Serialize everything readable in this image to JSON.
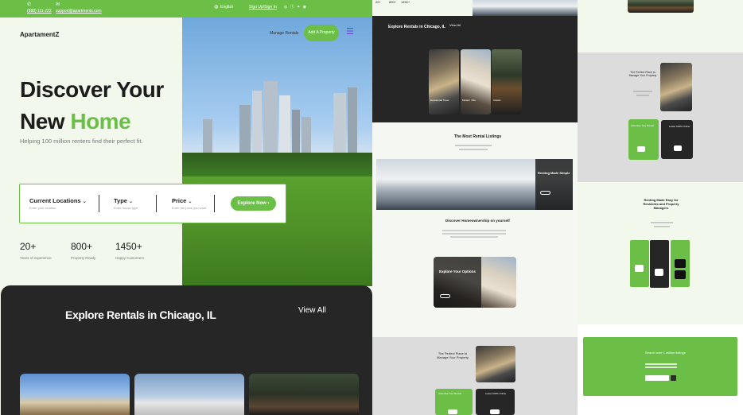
{
  "topbar": {
    "phone": "(888) 111-222",
    "email": "support@apartments.com",
    "language": "English",
    "signin": "Sign Up/Sign In"
  },
  "nav": {
    "logo": "ApartamentZ",
    "manage_rentals": "Manage Rentals",
    "add_property": "Add A Property"
  },
  "hero": {
    "title_line1": "Discover Your",
    "title_line2_a": "New ",
    "title_line2_b": "Home",
    "subtitle": "Helping 100 million renters find their perfect fit."
  },
  "search": {
    "location_label": "Current Locations",
    "location_hint": "Enter your location",
    "type_label": "Type",
    "type_hint": "Enter house type",
    "price_label": "Price",
    "price_hint": "Enter the price you want",
    "button": "Explore Now"
  },
  "stats": [
    {
      "value": "20+",
      "label": "Years of experience"
    },
    {
      "value": "800+",
      "label": "Property Ready"
    },
    {
      "value": "1450+",
      "label": "Happy Customers"
    }
  ],
  "explore": {
    "title": "Explore Rentals in Chicago, IL",
    "view_all": "View All"
  },
  "mini": {
    "explore_title": "Explore Rentals in Chicago, IL",
    "view_all": "View All",
    "card1": "Residential Tower",
    "card2": "Modern Villa",
    "card3": "Classic",
    "most_rental": "The Most Rental Listings",
    "renting_simple": "Renting Made Simple",
    "discover_ownership": "Discover Homeownership on yourself",
    "explore_options": "Explore Your Options",
    "perfect_place": "The Perfect Place to Manage Your Property",
    "advertise": "Advertise Your Rental",
    "lease_online": "Lease 100% Online",
    "renting_easy": "Renting Made Easy for Residents and Property Managers",
    "search_million": "Search over 1 million listings",
    "stats_mini": [
      "20+",
      "800+",
      "1450+"
    ]
  },
  "colors": {
    "accent": "#6bbf47",
    "dark": "#262626",
    "light_bg": "#f2f8ec"
  }
}
